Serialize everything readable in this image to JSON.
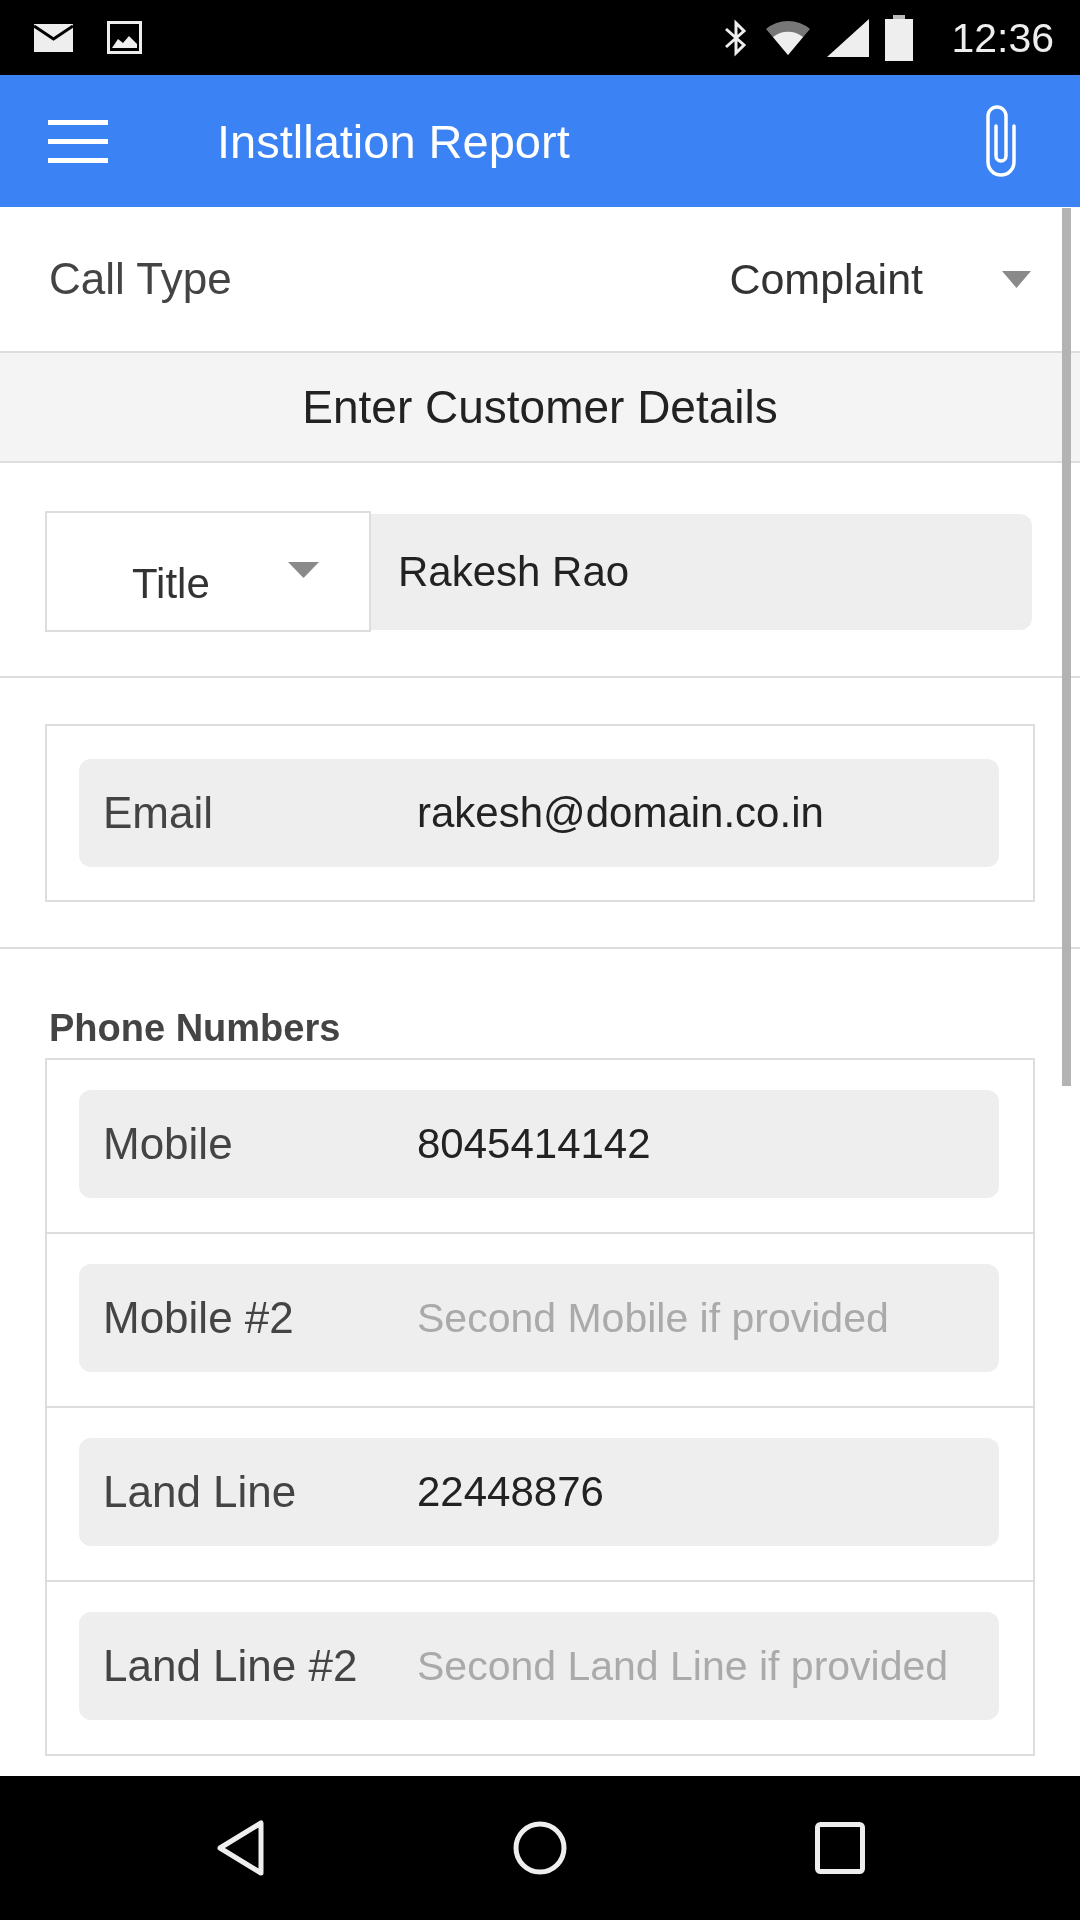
{
  "status_bar": {
    "time": "12:36"
  },
  "app_bar": {
    "title": "Instllation Report"
  },
  "call_type": {
    "label": "Call Type",
    "value": "Complaint"
  },
  "section_header": "Enter Customer Details",
  "customer_name": {
    "title_dropdown": "Title",
    "value": "Rakesh Rao"
  },
  "email": {
    "label": "Email",
    "value": "rakesh@domain.co.in"
  },
  "phone_numbers": {
    "heading": "Phone Numbers",
    "fields": [
      {
        "label": "Mobile",
        "value": "8045414142"
      },
      {
        "label": "Mobile #2",
        "placeholder": "Second Mobile if provided"
      },
      {
        "label": "Land Line",
        "value": "22448876"
      },
      {
        "label": "Land Line #2",
        "placeholder": "Second Land Line if provided"
      }
    ]
  }
}
